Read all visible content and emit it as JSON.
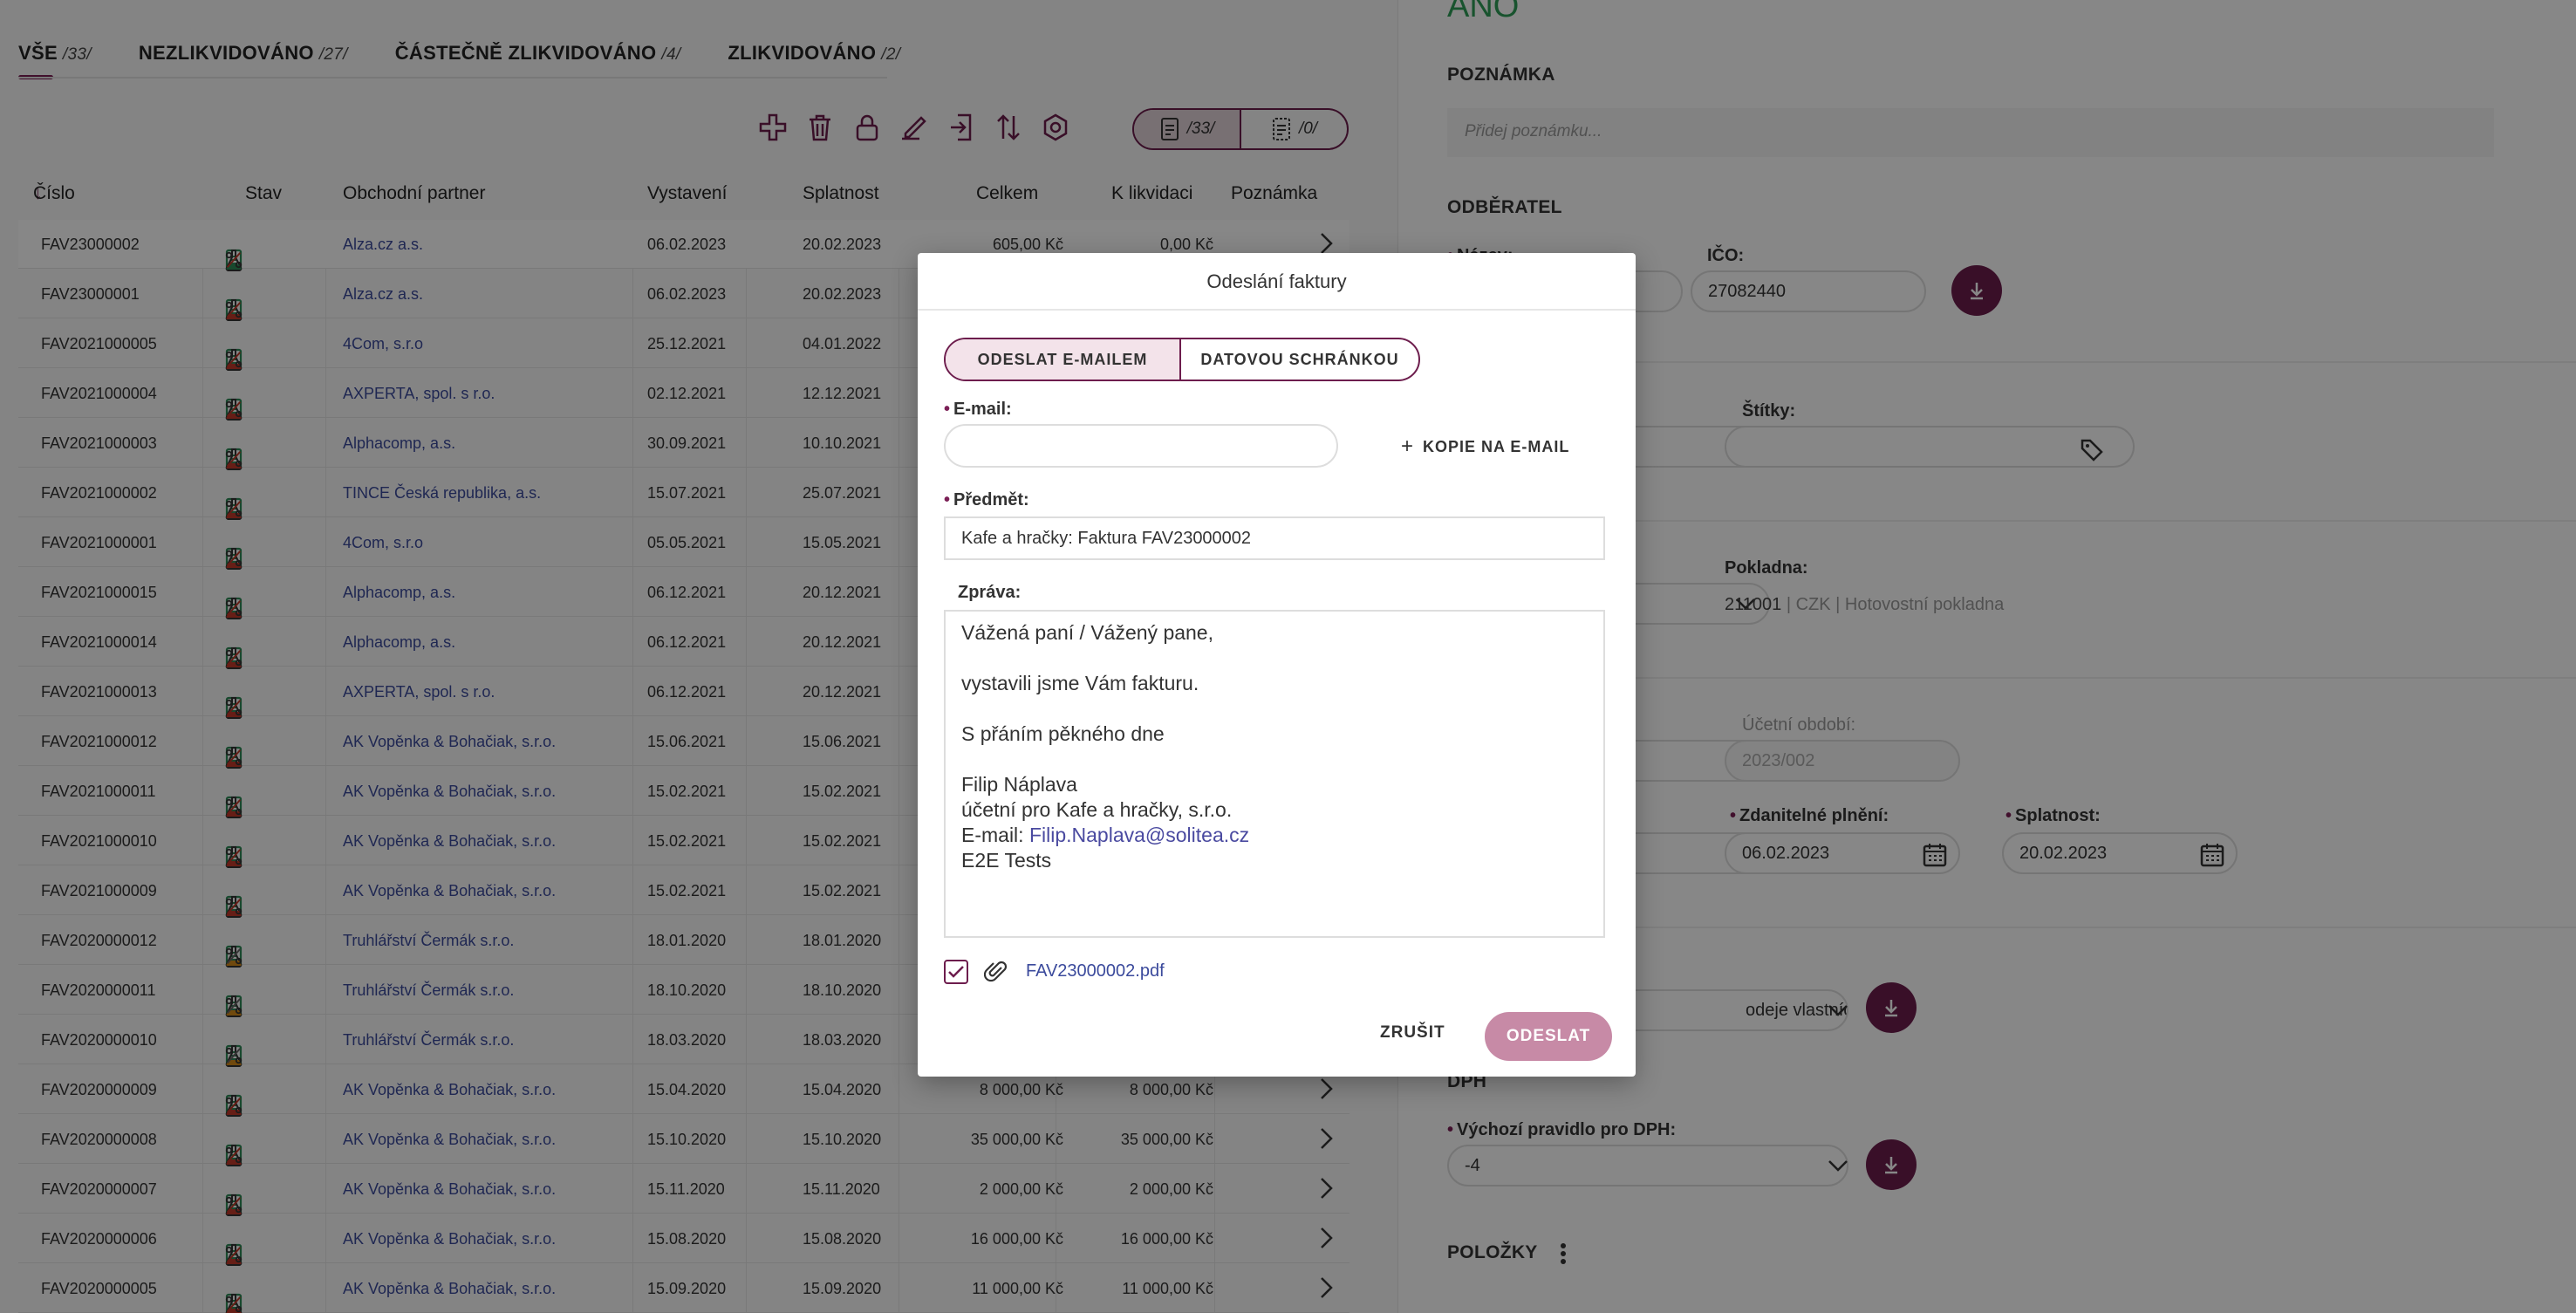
{
  "tabs": [
    {
      "label": "VŠE",
      "count": "/33/"
    },
    {
      "label": "NEZLIKVIDOVÁNO",
      "count": "/27/"
    },
    {
      "label": "ČÁSTEČNĚ ZLIKVIDOVÁNO",
      "count": "/4/"
    },
    {
      "label": "ZLIKVIDOVÁNO",
      "count": "/2/"
    }
  ],
  "toolbar": {
    "icons": [
      "add-icon",
      "delete-icon",
      "lock-icon",
      "edit-icon",
      "import-icon",
      "sort-icon",
      "settings-icon"
    ],
    "view_invoices_count": "/33/",
    "view_selected_count": "/0/"
  },
  "table": {
    "headers": {
      "cislo": "Číslo",
      "stav": "Stav",
      "partner": "Obchodní partner",
      "vystaveni": "Vystavení",
      "splatnost": "Splatnost",
      "celkem": "Celkem",
      "k_likvidaci": "K likvidaci",
      "poznamka": "Poznámka"
    },
    "rows": [
      {
        "cislo": "FAV23000002",
        "partner": "Alza.cz a.s.",
        "vystaveni": "06.02.2023",
        "splatnost": "20.02.2023",
        "celkem": "605,00 Kč",
        "k_likvidaci": "0,00 Kč"
      },
      {
        "cislo": "FAV23000001",
        "partner": "Alza.cz a.s.",
        "vystaveni": "06.02.2023",
        "splatnost": "20.02.2023",
        "celkem": "",
        "k_likvidaci": ""
      },
      {
        "cislo": "FAV2021000005",
        "partner": "4Com, s.r.o",
        "vystaveni": "25.12.2021",
        "splatnost": "04.01.2022",
        "celkem": "",
        "k_likvidaci": ""
      },
      {
        "cislo": "FAV2021000004",
        "partner": "AXPERTA, spol. s r.o.",
        "vystaveni": "02.12.2021",
        "splatnost": "12.12.2021",
        "celkem": "",
        "k_likvidaci": ""
      },
      {
        "cislo": "FAV2021000003",
        "partner": "Alphacomp, a.s.",
        "vystaveni": "30.09.2021",
        "splatnost": "10.10.2021",
        "celkem": "",
        "k_likvidaci": ""
      },
      {
        "cislo": "FAV2021000002",
        "partner": "TINCE Česká republika, a.s.",
        "vystaveni": "15.07.2021",
        "splatnost": "25.07.2021",
        "celkem": "",
        "k_likvidaci": ""
      },
      {
        "cislo": "FAV2021000001",
        "partner": "4Com, s.r.o",
        "vystaveni": "05.05.2021",
        "splatnost": "15.05.2021",
        "celkem": "",
        "k_likvidaci": ""
      },
      {
        "cislo": "FAV2021000015",
        "partner": "Alphacomp, a.s.",
        "vystaveni": "06.12.2021",
        "splatnost": "20.12.2021",
        "celkem": "",
        "k_likvidaci": ""
      },
      {
        "cislo": "FAV2021000014",
        "partner": "Alphacomp, a.s.",
        "vystaveni": "06.12.2021",
        "splatnost": "20.12.2021",
        "celkem": "",
        "k_likvidaci": ""
      },
      {
        "cislo": "FAV2021000013",
        "partner": "AXPERTA, spol. s r.o.",
        "vystaveni": "06.12.2021",
        "splatnost": "20.12.2021",
        "celkem": "",
        "k_likvidaci": ""
      },
      {
        "cislo": "FAV2021000012",
        "partner": "AK Vopěnka & Bohačiak, s.r.o.",
        "vystaveni": "15.06.2021",
        "splatnost": "15.06.2021",
        "celkem": "",
        "k_likvidaci": ""
      },
      {
        "cislo": "FAV2021000011",
        "partner": "AK Vopěnka & Bohačiak, s.r.o.",
        "vystaveni": "15.02.2021",
        "splatnost": "15.02.2021",
        "celkem": "",
        "k_likvidaci": ""
      },
      {
        "cislo": "FAV2021000010",
        "partner": "AK Vopěnka & Bohačiak, s.r.o.",
        "vystaveni": "15.02.2021",
        "splatnost": "15.02.2021",
        "celkem": "",
        "k_likvidaci": ""
      },
      {
        "cislo": "FAV2021000009",
        "partner": "AK Vopěnka & Bohačiak, s.r.o.",
        "vystaveni": "15.02.2021",
        "splatnost": "15.02.2021",
        "celkem": "",
        "k_likvidaci": ""
      },
      {
        "cislo": "FAV2020000012",
        "partner": "Truhlářství Čermák s.r.o.",
        "vystaveni": "18.01.2020",
        "splatnost": "18.01.2020",
        "celkem": "",
        "k_likvidaci": ""
      },
      {
        "cislo": "FAV2020000011",
        "partner": "Truhlářství Čermák s.r.o.",
        "vystaveni": "18.10.2020",
        "splatnost": "18.10.2020",
        "celkem": "",
        "k_likvidaci": ""
      },
      {
        "cislo": "FAV2020000010",
        "partner": "Truhlářství Čermák s.r.o.",
        "vystaveni": "18.03.2020",
        "splatnost": "18.03.2020",
        "celkem": "",
        "k_likvidaci": ""
      },
      {
        "cislo": "FAV2020000009",
        "partner": "AK Vopěnka & Bohačiak, s.r.o.",
        "vystaveni": "15.04.2020",
        "splatnost": "15.04.2020",
        "celkem": "8 000,00 Kč",
        "k_likvidaci": "8 000,00 Kč"
      },
      {
        "cislo": "FAV2020000008",
        "partner": "AK Vopěnka & Bohačiak, s.r.o.",
        "vystaveni": "15.10.2020",
        "splatnost": "15.10.2020",
        "celkem": "35 000,00 Kč",
        "k_likvidaci": "35 000,00 Kč"
      },
      {
        "cislo": "FAV2020000007",
        "partner": "AK Vopěnka & Bohačiak, s.r.o.",
        "vystaveni": "15.11.2020",
        "splatnost": "15.11.2020",
        "celkem": "2 000,00 Kč",
        "k_likvidaci": "2 000,00 Kč"
      },
      {
        "cislo": "FAV2020000006",
        "partner": "AK Vopěnka & Bohačiak, s.r.o.",
        "vystaveni": "15.08.2020",
        "splatnost": "15.08.2020",
        "celkem": "16 000,00 Kč",
        "k_likvidaci": "16 000,00 Kč"
      },
      {
        "cislo": "FAV2020000005",
        "partner": "AK Vopěnka & Bohačiak, s.r.o.",
        "vystaveni": "15.09.2020",
        "splatnost": "15.09.2020",
        "celkem": "11 000,00 Kč",
        "k_likvidaci": "11 000,00 Kč"
      }
    ]
  },
  "detail": {
    "ano": "ANO",
    "poznamka_heading": "POZNÁMKA",
    "poznamka_placeholder": "Přidej poznámku...",
    "odberatel_heading": "ODBĚRATEL",
    "nazev_label": "Název:",
    "ico_label": "IČO:",
    "ico_value": "27082440",
    "stitky_label": "Štítky:",
    "pokladna_label": "Pokladna:",
    "pokladna_code": "211001",
    "pokladna_rest": "| CZK | Hotovostní pokladna",
    "ucetni_obdobi_label": "Účetní období:",
    "ucetni_obdobi_value": "2023/002",
    "zdanitelne_label": "Zdanitelné plnění:",
    "zdanitelne_value": "06.02.2023",
    "splatnost_label": "Splatnost:",
    "splatnost_value": "20.02.2023",
    "typ_value": "odeje vlastních v...",
    "dph_heading": "DPH",
    "dph_rule_label": "Výchozí pravidlo pro DPH:",
    "dph_rule_value": "-4",
    "polozky_heading": "POLOŽKY"
  },
  "modal": {
    "title": "Odeslání faktury",
    "tab_email": "ODESLAT E-MAILEM",
    "tab_datovka": "DATOVOU SCHRÁNKOU",
    "email_label": "E-mail:",
    "email_value": "",
    "kopie_label": "KOPIE NA E-MAIL",
    "predmet_label": "Předmět:",
    "predmet_value": "Kafe a hračky: Faktura FAV23000002",
    "zprava_label": "Zpráva:",
    "zprava_line1": "Vážená paní / Vážený pane,",
    "zprava_line2": "vystavili jsme Vám fakturu.",
    "zprava_line3": "S přáním pěkného dne",
    "zprava_line4": "Filip Náplava",
    "zprava_line5": "účetní pro Kafe a hračky, s.r.o.",
    "zprava_email_prefix": "E-mail: ",
    "zprava_email": "Filip.Naplava@solitea.cz",
    "zprava_line7": "E2E Tests",
    "attachment_checked": true,
    "attachment_name": "FAV23000002.pdf",
    "cancel_label": "ZRUŠIT",
    "send_label": "ODESLAT"
  },
  "colors": {
    "accent": "#6d1d4d",
    "state_green": "#2e8b57",
    "state_red": "#c0392b",
    "state_orange": "#d48a1a",
    "link": "#3b4a9c"
  }
}
